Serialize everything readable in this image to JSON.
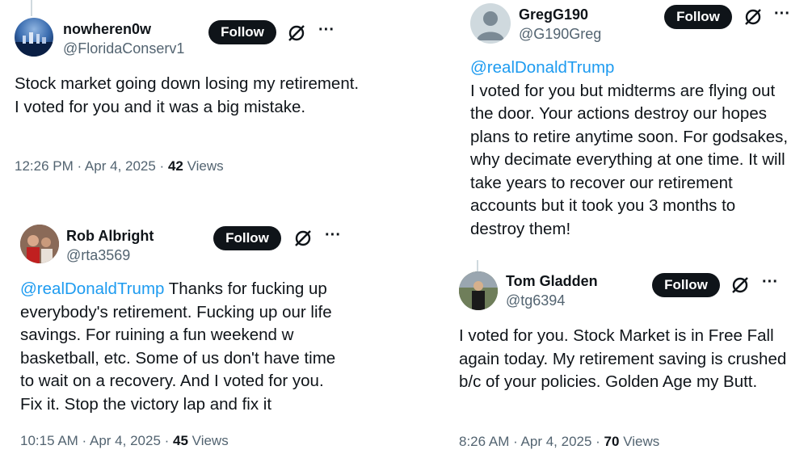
{
  "tweets": [
    {
      "name": "nowheren0w",
      "handle": "@FloridaConserv1",
      "follow_label": "Follow",
      "more": "···",
      "mention": "",
      "text": "Stock market going down losing my retirement.  I voted for you and it was a big mistake.",
      "time": "12:26 PM · Apr 4, 2025 · ",
      "views_count": "42",
      "views_label": " Views"
    },
    {
      "name": "Rob Albright",
      "handle": "@rta3569",
      "follow_label": "Follow",
      "more": "···",
      "mention": "@realDonaldTrump",
      "text": " Thanks for fucking up everybody's retirement.  Fucking up our life savings.  For ruining a fun weekend w basketball, etc.  Some of us don't have time to wait on a recovery.  And I voted for you.  Fix it.  Stop the victory lap and fix it",
      "time": "10:15 AM · Apr 4, 2025 · ",
      "views_count": "45",
      "views_label": " Views"
    },
    {
      "name": "GregG190",
      "handle": "@G190Greg",
      "follow_label": "Follow",
      "more": "···",
      "mention": "@realDonaldTrump",
      "text": "I voted for you but midterms are flying out the door. Your actions destroy our hopes plans to retire anytime soon. For godsakes, why decimate everything at one time. It will take years to recover our retirement accounts but it took you 3 months to destroy them!"
    },
    {
      "name": "Tom Gladden",
      "handle": "@tg6394",
      "follow_label": "Follow",
      "more": "···",
      "mention": "",
      "text": "I voted for you. Stock Market is in Free Fall again today. My retirement saving is crushed b/c of your policies. Golden Age my Butt.",
      "time": "8:26 AM · Apr 4, 2025 · ",
      "views_count": "70",
      "views_label": " Views"
    }
  ]
}
